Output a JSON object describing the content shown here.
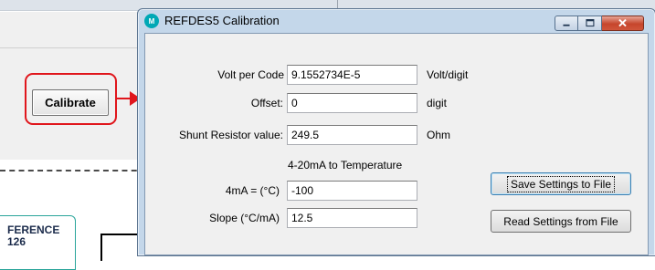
{
  "background": {
    "calibrate_button": "Calibrate",
    "reference_box": {
      "line1": "FERENCE",
      "line2": "126"
    }
  },
  "dialog": {
    "title": "REFDES5 Calibration",
    "icon_text": "M",
    "fields": {
      "volt_per_code": {
        "label": "Volt per Code",
        "value": "9.1552734E-5",
        "unit": "Volt/digit"
      },
      "offset": {
        "label": "Offset:",
        "value": "0",
        "unit": "digit"
      },
      "shunt_resistor": {
        "label": "Shunt Resistor value:",
        "value": "249.5",
        "unit": "Ohm"
      },
      "section_title": "4-20mA to Temperature",
      "four_ma": {
        "label": "4mA = (°C)",
        "value": "-100"
      },
      "slope": {
        "label": "Slope (°C/mA)",
        "value": "12.5"
      }
    },
    "buttons": {
      "save": "Save Settings to File",
      "read": "Read Settings from File"
    }
  },
  "colors": {
    "highlight_red": "#e0161c",
    "dialog_frame": "#c4d7ea",
    "close_button": "#c6452c",
    "app_icon": "#00a8b5"
  }
}
